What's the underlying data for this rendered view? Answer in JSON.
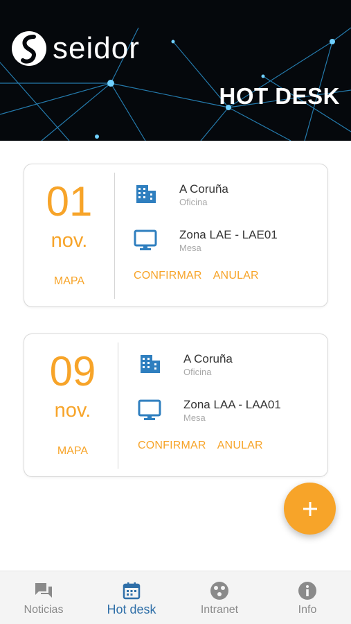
{
  "header": {
    "brand": "seidor",
    "title": "HOT DESK"
  },
  "reservations": [
    {
      "day": "01",
      "month": "nov.",
      "map_label": "MAPA",
      "location": {
        "title": "A Coruña",
        "subtitle": "Oficina",
        "icon": "building-icon"
      },
      "desk": {
        "title": "Zona LAE - LAE01",
        "subtitle": "Mesa",
        "icon": "monitor-icon"
      },
      "confirm_label": "CONFIRMAR",
      "cancel_label": "ANULAR"
    },
    {
      "day": "09",
      "month": "nov.",
      "map_label": "MAPA",
      "location": {
        "title": "A Coruña",
        "subtitle": "Oficina",
        "icon": "building-icon"
      },
      "desk": {
        "title": "Zona LAA - LAA01",
        "subtitle": "Mesa",
        "icon": "monitor-icon"
      },
      "confirm_label": "CONFIRMAR",
      "cancel_label": "ANULAR"
    }
  ],
  "fab": {
    "icon": "plus-icon"
  },
  "bottom_nav": {
    "items": [
      {
        "label": "Noticias",
        "icon": "chat-icon",
        "active": false
      },
      {
        "label": "Hot desk",
        "icon": "calendar-icon",
        "active": true
      },
      {
        "label": "Intranet",
        "icon": "globe-icon",
        "active": false
      },
      {
        "label": "Info",
        "icon": "info-icon",
        "active": false
      }
    ]
  },
  "colors": {
    "accent": "#f7a429",
    "icon_blue": "#2f7fbf",
    "nav_active": "#2f6fa8",
    "nav_inactive": "#8a8a8a",
    "header_bg": "#05080c"
  }
}
